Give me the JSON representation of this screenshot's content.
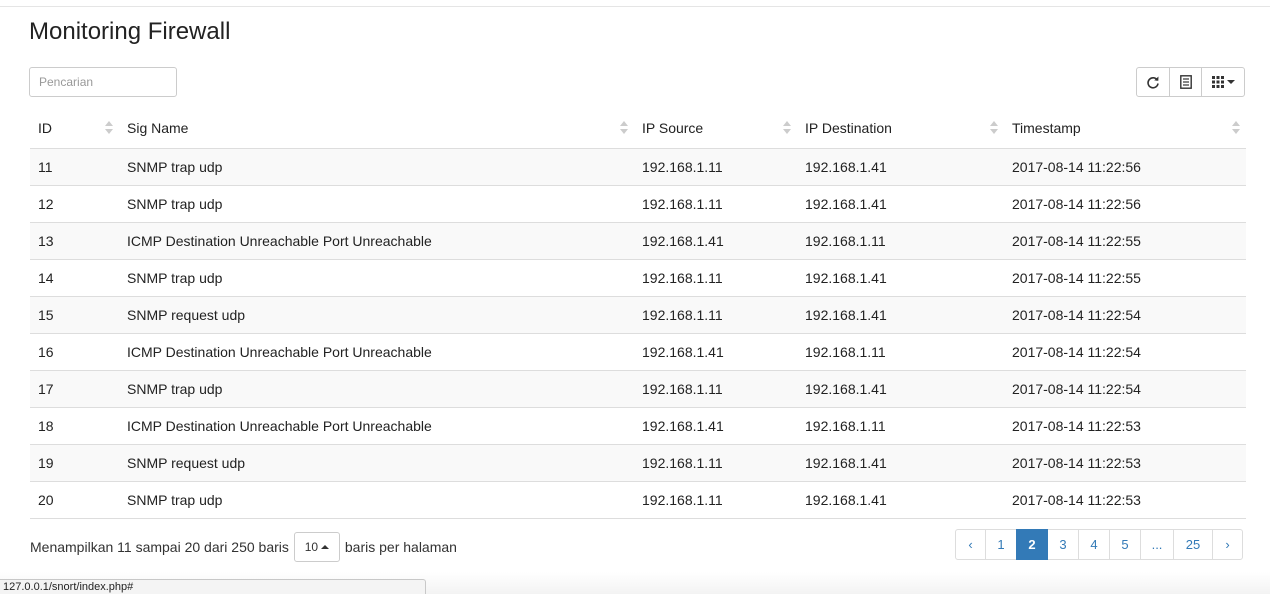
{
  "page": {
    "title": "Monitoring Firewall"
  },
  "search": {
    "placeholder": "Pencarian",
    "value": ""
  },
  "toolbar": {
    "icons": [
      "refresh-icon",
      "list-toggle-icon",
      "columns-grid-icon"
    ]
  },
  "table": {
    "headers": {
      "id": "ID",
      "sig_name": "Sig Name",
      "ip_source": "IP Source",
      "ip_destination": "IP Destination",
      "timestamp": "Timestamp"
    },
    "rows": [
      {
        "id": "11",
        "sig_name": "SNMP trap udp",
        "ip_source": "192.168.1.11",
        "ip_destination": "192.168.1.41",
        "timestamp": "2017-08-14 11:22:56"
      },
      {
        "id": "12",
        "sig_name": "SNMP trap udp",
        "ip_source": "192.168.1.11",
        "ip_destination": "192.168.1.41",
        "timestamp": "2017-08-14 11:22:56"
      },
      {
        "id": "13",
        "sig_name": "ICMP Destination Unreachable Port Unreachable",
        "ip_source": "192.168.1.41",
        "ip_destination": "192.168.1.11",
        "timestamp": "2017-08-14 11:22:55"
      },
      {
        "id": "14",
        "sig_name": "SNMP trap udp",
        "ip_source": "192.168.1.11",
        "ip_destination": "192.168.1.41",
        "timestamp": "2017-08-14 11:22:55"
      },
      {
        "id": "15",
        "sig_name": "SNMP request udp",
        "ip_source": "192.168.1.11",
        "ip_destination": "192.168.1.41",
        "timestamp": "2017-08-14 11:22:54"
      },
      {
        "id": "16",
        "sig_name": "ICMP Destination Unreachable Port Unreachable",
        "ip_source": "192.168.1.41",
        "ip_destination": "192.168.1.11",
        "timestamp": "2017-08-14 11:22:54"
      },
      {
        "id": "17",
        "sig_name": "SNMP trap udp",
        "ip_source": "192.168.1.11",
        "ip_destination": "192.168.1.41",
        "timestamp": "2017-08-14 11:22:54"
      },
      {
        "id": "18",
        "sig_name": "ICMP Destination Unreachable Port Unreachable",
        "ip_source": "192.168.1.41",
        "ip_destination": "192.168.1.11",
        "timestamp": "2017-08-14 11:22:53"
      },
      {
        "id": "19",
        "sig_name": "SNMP request udp",
        "ip_source": "192.168.1.11",
        "ip_destination": "192.168.1.41",
        "timestamp": "2017-08-14 11:22:53"
      },
      {
        "id": "20",
        "sig_name": "SNMP trap udp",
        "ip_source": "192.168.1.11",
        "ip_destination": "192.168.1.41",
        "timestamp": "2017-08-14 11:22:53"
      }
    ]
  },
  "footer": {
    "showing_text": "Menampilkan 11 sampai 20 dari 250 baris",
    "page_size": "10",
    "per_page_text": "baris per halaman"
  },
  "pagination": {
    "items": [
      "‹",
      "1",
      "2",
      "3",
      "4",
      "5",
      "...",
      "25",
      "›"
    ],
    "active": "2",
    "accent_color": "#337ab7"
  },
  "statusbar": {
    "url": "127.0.0.1/snort/index.php#"
  }
}
